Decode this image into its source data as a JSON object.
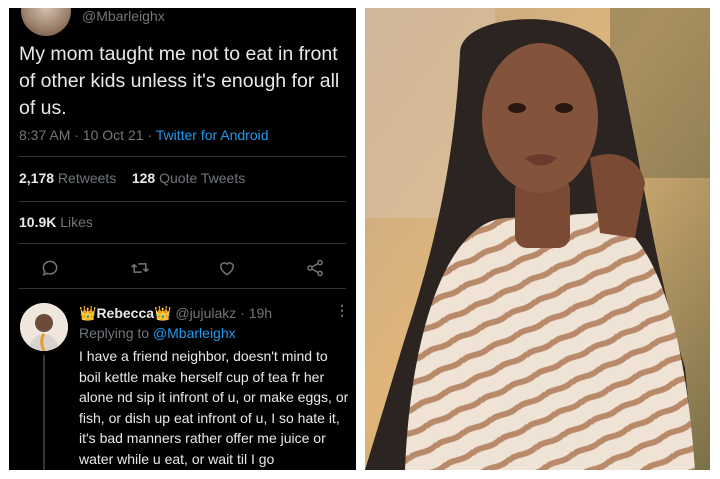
{
  "tweet": {
    "handle": "@Mbarleighx",
    "text": "My mom taught me not to eat in front of other kids unless it's enough for all of us.",
    "time": "8:37 AM · 10 Oct 21 · ",
    "source": "Twitter for Android",
    "retweets_count": "2,178",
    "retweets_label": " Retweets",
    "quotes_count": "128",
    "quotes_label": " Quote Tweets",
    "likes_count": "10.9K",
    "likes_label": " Likes",
    "actions": [
      "reply-icon",
      "retweet-icon",
      "like-icon",
      "share-icon"
    ]
  },
  "reply": {
    "crown": "👑",
    "name": "Rebecca",
    "handle_time": " @jujulakz · 19h",
    "replying_prefix": "Replying to ",
    "replying_to": "@Mbarleighx",
    "text": "I have a friend neighbor, doesn't mind to boil kettle make herself cup of tea fr her alone nd sip it infront of u, or make eggs, or fish, or dish up eat infront of u, I so hate it, it's bad manners rather offer me juice or water while u eat, or wait til I go",
    "more": "⋮"
  },
  "colors": {
    "background": "#000000",
    "text": "#e7e9ea",
    "muted": "#71767b",
    "link": "#1d9bf0",
    "divider": "#2f3336"
  }
}
